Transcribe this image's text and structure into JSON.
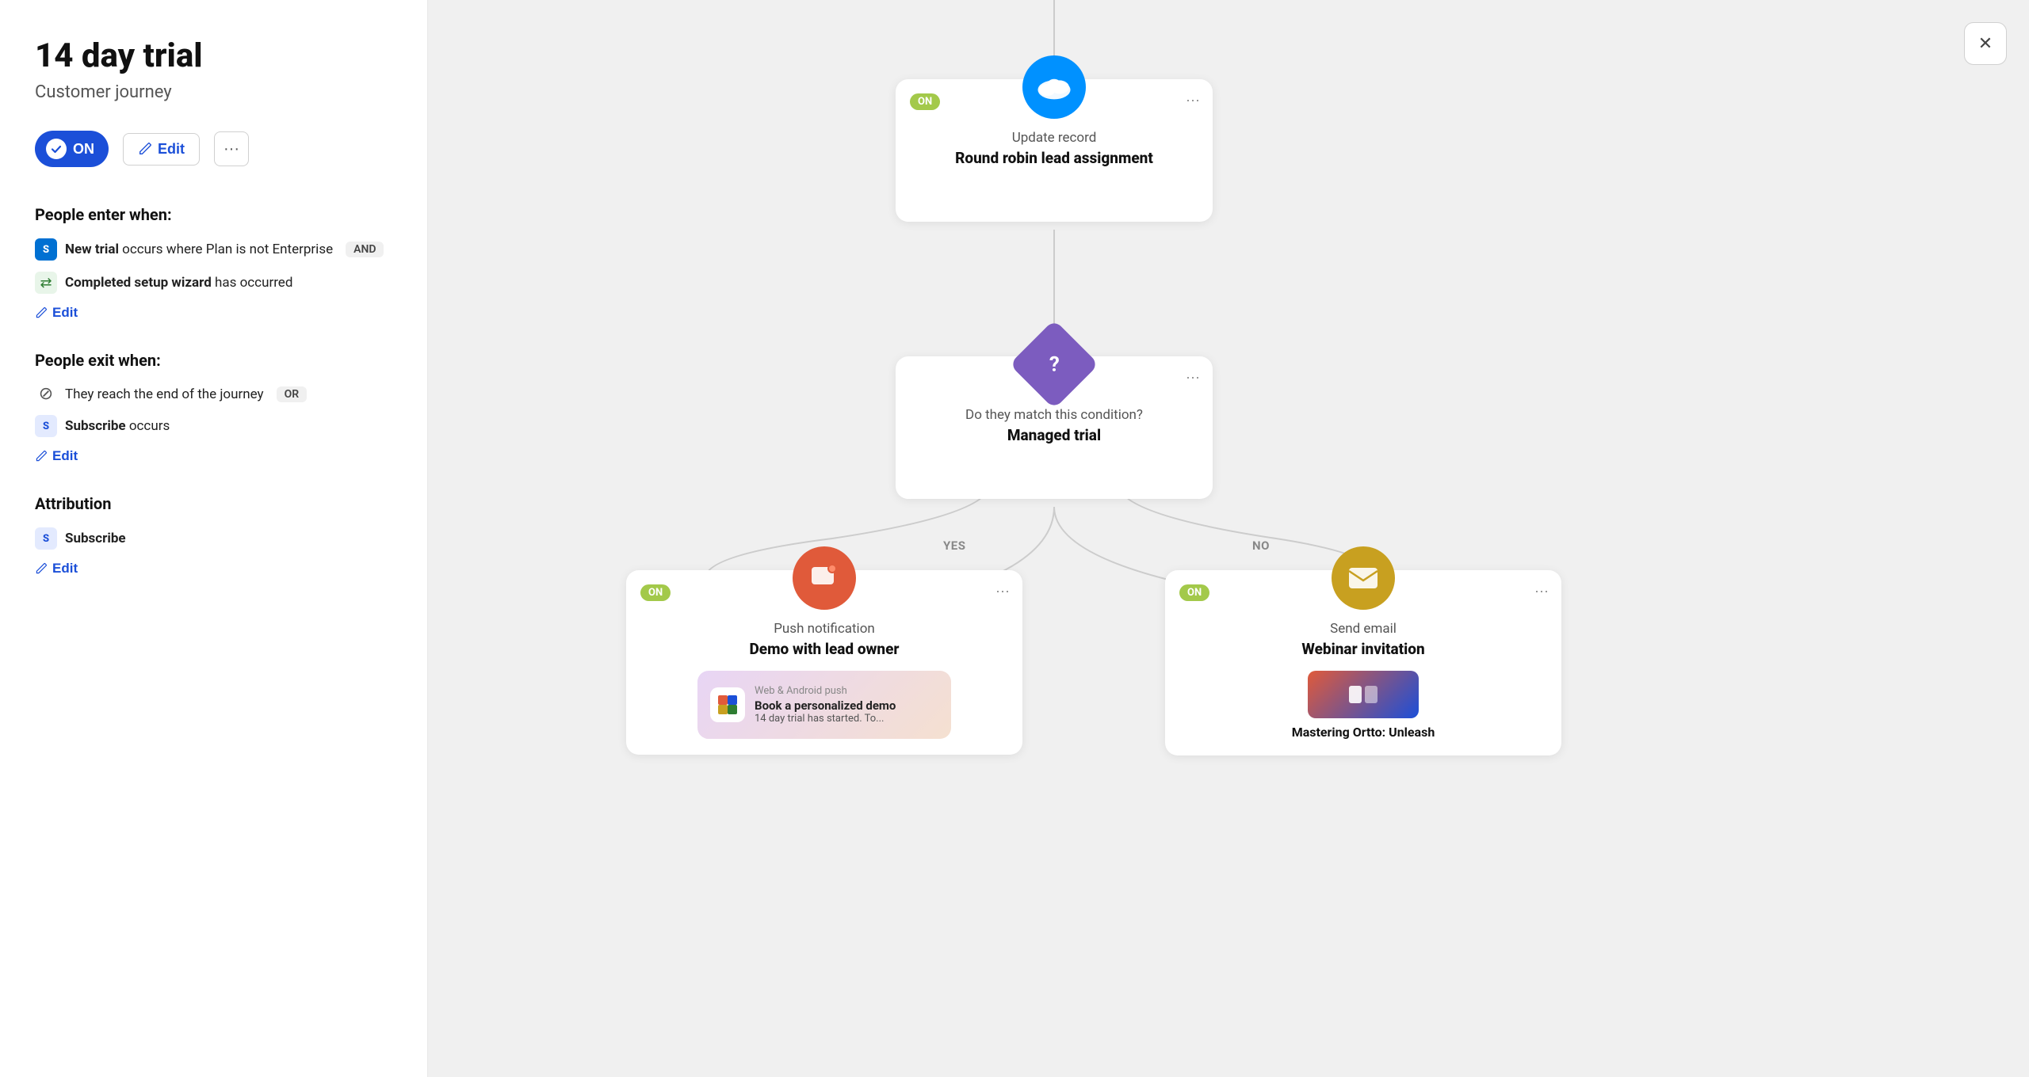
{
  "left": {
    "title": "14 day trial",
    "subtitle": "Customer journey",
    "toggle_label": "ON",
    "edit_label": "Edit",
    "more_label": "···",
    "people_enter_title": "People enter when:",
    "enter_conditions": [
      {
        "icon_type": "salesforce",
        "icon_text": "S",
        "text_bold": "New trial",
        "text_rest": " occurs where Plan is not Enterprise",
        "badge": "AND"
      },
      {
        "icon_type": "setup",
        "icon_text": "⇄",
        "text_bold": "Completed setup wizard",
        "text_rest": " has occurred",
        "badge": null
      }
    ],
    "enter_edit_label": "Edit",
    "people_exit_title": "People exit when:",
    "exit_conditions": [
      {
        "icon_type": "ban",
        "icon_text": "⊘",
        "text_bold": null,
        "text_rest": "They reach the end of the journey",
        "badge": "OR"
      },
      {
        "icon_type": "salesforce",
        "icon_text": "S",
        "text_bold": "Subscribe",
        "text_rest": " occurs",
        "badge": null
      }
    ],
    "exit_edit_label": "Edit",
    "attribution_title": "Attribution",
    "attribution_item_icon": "S",
    "attribution_item_text": "Subscribe",
    "attribution_edit_label": "Edit"
  },
  "canvas": {
    "close_label": "✕",
    "node_update": {
      "on_badge": "ON",
      "action": "Update record",
      "title": "Round robin lead assignment",
      "more": "···"
    },
    "node_condition": {
      "more": "···",
      "question_mark": "?",
      "action": "Do they match this condition?",
      "title": "Managed trial"
    },
    "branch_yes": "YES",
    "branch_no": "NO",
    "node_push": {
      "on_badge": "ON",
      "action": "Push notification",
      "title": "Demo with lead owner",
      "more": "···",
      "preview_label": "Web & Android push",
      "preview_title": "Book a personalized demo",
      "preview_sub": "14 day trial has started. To..."
    },
    "node_email": {
      "on_badge": "ON",
      "action": "Send email",
      "title": "Webinar invitation",
      "more": "···",
      "webinar_title": "Mastering Ortto: Unleash"
    }
  },
  "colors": {
    "blue": "#1b4fd8",
    "salesforce": "#0091ff",
    "green_badge": "#a3c94a",
    "purple": "#7c5cbf",
    "orange_red": "#e05a3a",
    "gold": "#c8a020"
  }
}
